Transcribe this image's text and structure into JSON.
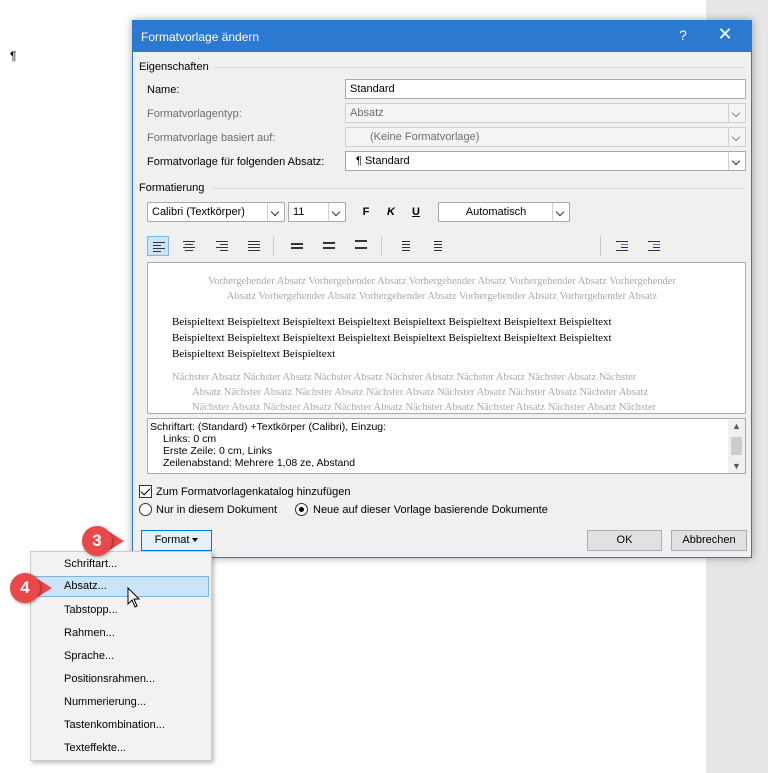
{
  "doc": {
    "pilcrow": "¶"
  },
  "dialog": {
    "title": "Formatvorlage ändern",
    "help": "?",
    "close": "✕",
    "properties": {
      "group": "Eigenschaften",
      "name_label": "Name:",
      "name_value": "Standard",
      "type_label": "Formatvorlagentyp:",
      "type_value": "Absatz",
      "based_label": "Formatvorlage basiert auf:",
      "based_value": "(Keine Formatvorlage)",
      "next_label": "Formatvorlage für folgenden Absatz:",
      "next_value": "¶  Standard"
    },
    "formatting": {
      "group": "Formatierung",
      "font": "Calibri (Textkörper)",
      "size": "11",
      "bold": "F",
      "italic": "K",
      "underline": "U",
      "color": "Automatisch"
    },
    "preview": {
      "prev_line1": "Vorhergehender Absatz Vorhergehender Absatz Vorhergehender Absatz Vorhergehender Absatz Vorhergehender",
      "prev_line2": "Absatz Vorhergehender Absatz Vorhergehender Absatz Vorhergehender Absatz Vorhergehender Absatz",
      "sample_line1": "Beispieltext Beispieltext Beispieltext Beispieltext Beispieltext Beispieltext Beispieltext Beispieltext",
      "sample_line2": "Beispieltext Beispieltext Beispieltext Beispieltext Beispieltext Beispieltext Beispieltext Beispieltext",
      "sample_line3": "Beispieltext Beispieltext Beispieltext",
      "next_line1": "Nächster Absatz Nächster Absatz Nächster Absatz Nächster Absatz Nächster Absatz Nächster Absatz Nächster",
      "next_line2": "Absatz Nächster Absatz Nächster Absatz Nächster Absatz Nächster Absatz Nächster Absatz Nächster Absatz",
      "next_line3": "Nächster Absatz Nächster Absatz Nächster Absatz Nächster Absatz Nächster Absatz Nächster Absatz Nächster"
    },
    "description": {
      "line1": "Schriftart: (Standard) +Textkörper (Calibri), Einzug:",
      "line2": "Links:  0 cm",
      "line3": "Erste Zeile:  0 cm, Links",
      "line4": "Zeilenabstand:  Mehrere 1,08 ze, Abstand"
    },
    "add_to_gallery": "Zum Formatvorlagenkatalog hinzufügen",
    "only_this_doc": "Nur in diesem Dokument",
    "new_docs": "Neue auf dieser Vorlage basierende Dokumente",
    "format_button": "Format",
    "ok": "OK",
    "cancel": "Abbrechen"
  },
  "menu": {
    "items": [
      "Schriftart...",
      "Absatz...",
      "Tabstopp...",
      "Rahmen...",
      "Sprache...",
      "Positionsrahmen...",
      "Nummerierung...",
      "Tastenkombination...",
      "Texteffekte..."
    ]
  },
  "callouts": {
    "step3": "3",
    "step4": "4"
  },
  "colors": {
    "titlebar": "#2b79d0",
    "callout": "#ea4848",
    "highlight": "#cce4f7"
  }
}
